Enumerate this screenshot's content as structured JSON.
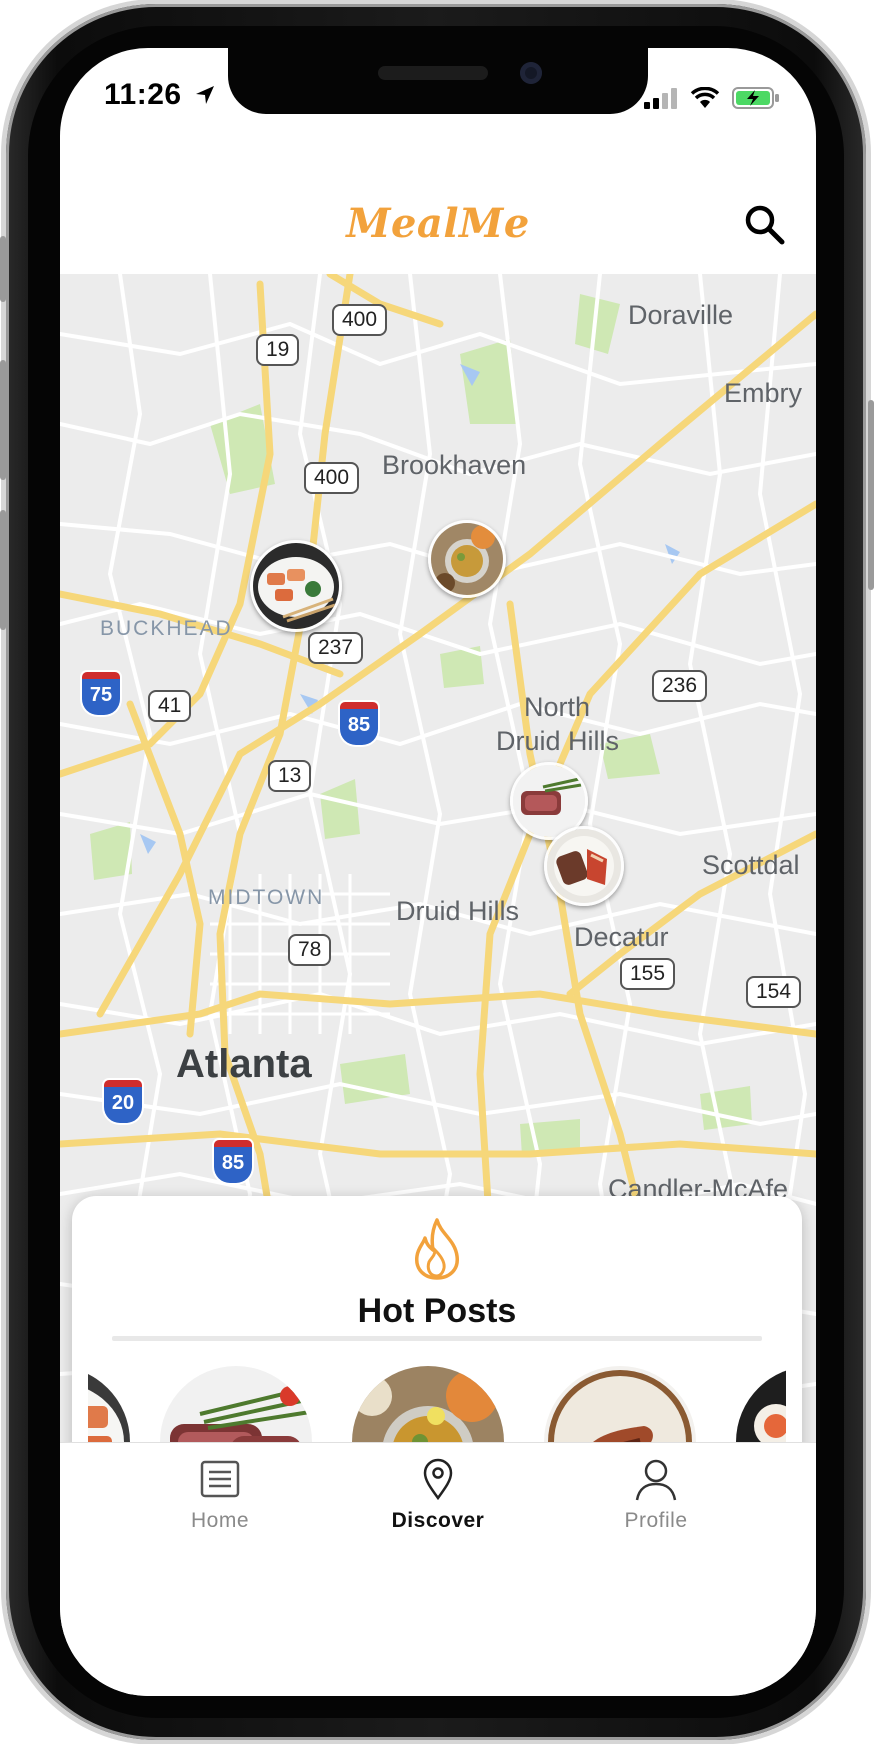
{
  "status_bar": {
    "time": "11:26"
  },
  "header": {
    "title": "MealMe"
  },
  "map": {
    "districts": [
      "BUCKHEAD",
      "MIDTOWN"
    ],
    "places": [
      "Doraville",
      "Embry",
      "Brookhaven",
      "North",
      "Druid Hills",
      "Scottdal",
      "Druid Hills",
      "Decatur",
      "Candler-McAfe"
    ],
    "city": "Atlanta",
    "route_shields": [
      "400",
      "19",
      "400",
      "237",
      "41",
      "13",
      "78",
      "236",
      "155",
      "154"
    ],
    "interstates": [
      "75",
      "85",
      "20",
      "85"
    ]
  },
  "hot_posts": {
    "title": "Hot Posts"
  },
  "tabs": [
    {
      "label": "Home",
      "icon": "list-icon"
    },
    {
      "label": "Discover",
      "icon": "map-pin-icon"
    },
    {
      "label": "Profile",
      "icon": "person-icon"
    }
  ],
  "colors": {
    "brand": "#f2a23c",
    "map_road": "#f6d77a",
    "map_park": "#cfe8b4",
    "map_water": "#a7c8f2"
  }
}
